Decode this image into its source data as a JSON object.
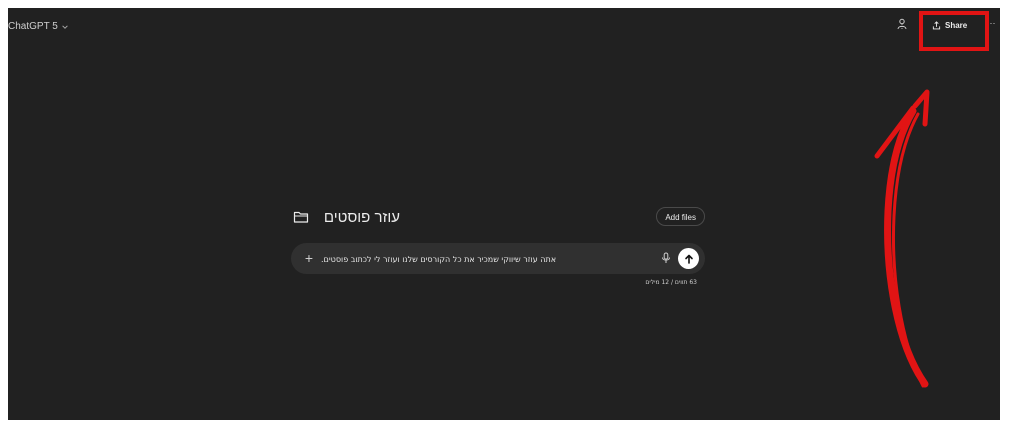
{
  "header": {
    "model_name": "ChatGPT 5",
    "share_label": "Share",
    "more_label": "···"
  },
  "project": {
    "name": "עוזר פוסטים",
    "add_files_label": "Add files"
  },
  "composer": {
    "prompt_text": "אתה עוזר שיווקי שמכיר את כל הקורסים שלנו ועוזר לי לכתוב פוסטים.",
    "counter": "63 תווים / 12 מילים"
  },
  "icons": {
    "model_chevron": "chevron-down-icon",
    "temporary_chat": "temporary-chat-icon",
    "share": "share-upload-icon",
    "folder": "folder-icon",
    "plus": "plus-icon",
    "mic": "microphone-icon",
    "send": "arrow-up-icon"
  },
  "colors": {
    "background": "#212121",
    "composer": "#303030",
    "annotation": "#e11414",
    "text": "#ececec"
  }
}
